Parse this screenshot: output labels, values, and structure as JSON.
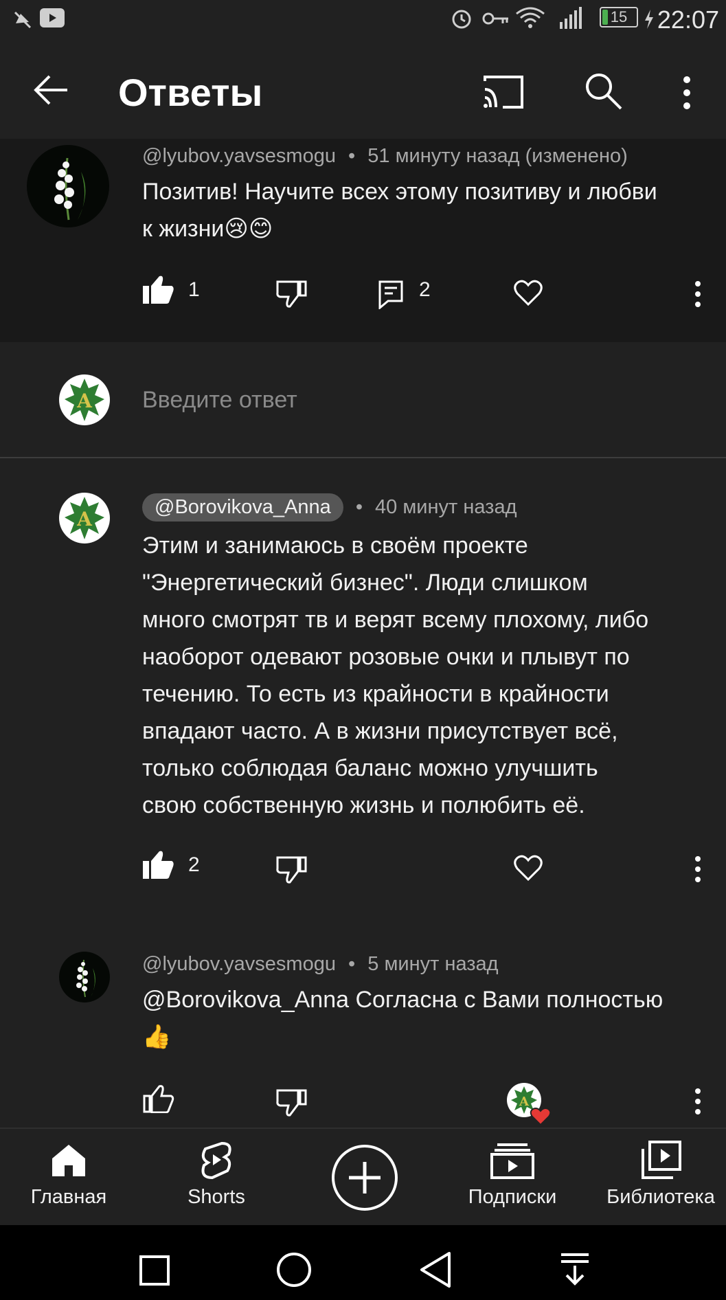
{
  "status_bar": {
    "time": "22:07",
    "battery": "15",
    "icons": [
      "mute-icon",
      "youtube-icon",
      "alarm-icon",
      "key-icon",
      "wifi-icon",
      "signal-icon",
      "battery-icon"
    ]
  },
  "app_bar": {
    "title": "Ответы",
    "icons": [
      "back-arrow-icon",
      "cast-icon",
      "search-icon",
      "more-vert-icon"
    ]
  },
  "parent_comment": {
    "author": "@lyubov.yavsesmogu",
    "separator": "•",
    "time": "51 минуту назад (изменено)",
    "text_line1": "Позитив! Научите всех этому позитиву и любви",
    "text_line2": "к жизни",
    "emoji": "😢😊",
    "likes": "1",
    "replies": "2"
  },
  "reply_input": {
    "placeholder": "Введите ответ"
  },
  "replies": [
    {
      "author": "@Borovikova_Anna",
      "separator": "•",
      "time": "40 минут назад",
      "lines": [
        "Этим и занимаюсь в своём проекте",
        "\"Энергетический бизнес\". Люди слишком",
        "много смотрят тв и верят всему плохому, либо",
        "наоборот одевают розовые очки и плывут по",
        "течению. То есть из крайности в крайности",
        "впадают часто. А в жизни присутствует всё,",
        "только соблюдая баланс можно улучшить",
        "свою собственную жизнь и полюбить её."
      ],
      "likes": "2"
    },
    {
      "author": "@lyubov.yavsesmogu",
      "separator": "•",
      "time": "5 минут назад",
      "text_line1": "@Borovikova_Anna  Согласна с Вами полностью",
      "emoji": "👍"
    }
  ],
  "bottom_nav": [
    {
      "label": "Главная",
      "icon": "home-icon"
    },
    {
      "label": "Shorts",
      "icon": "shorts-icon"
    },
    {
      "label": "",
      "icon": "create-icon"
    },
    {
      "label": "Подписки",
      "icon": "subscriptions-icon"
    },
    {
      "label": "Библиотека",
      "icon": "library-icon"
    }
  ],
  "system_nav": [
    "recents-icon",
    "home-circle-icon",
    "back-triangle-icon",
    "notification-pull-icon"
  ],
  "colors": {
    "background": "#212121",
    "parent_background": "#191919",
    "text_primary": "#f1f1f1",
    "text_secondary": "#a8a8a8",
    "accent_heart": "#e53935",
    "avatar_green": "#2e7d32"
  }
}
